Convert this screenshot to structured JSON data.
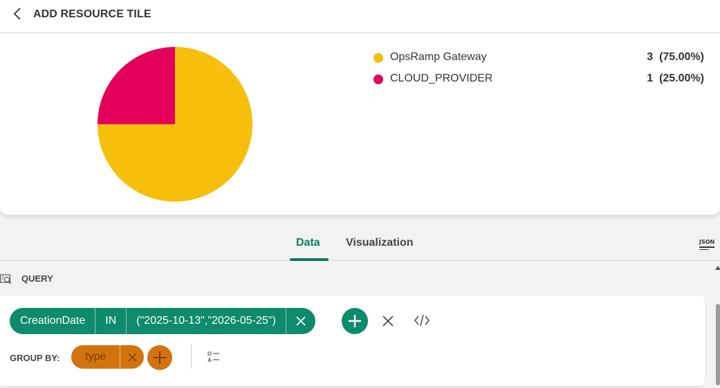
{
  "header": {
    "title": "ADD RESOURCE TILE",
    "back_icon": "chevron-left-icon"
  },
  "chart_data": {
    "type": "pie",
    "slices": [
      {
        "name": "OpsRamp Gateway",
        "value": 3,
        "percent": "75.00%",
        "color": "#f5bf0c",
        "display": "3  (75.00%)"
      },
      {
        "name": "CLOUD_PROVIDER",
        "value": 1,
        "percent": "25.00%",
        "color": "#e3005a",
        "display": "1  (25.00%)"
      }
    ],
    "legend_position": "right"
  },
  "tabs": [
    {
      "label": "Data",
      "active": true
    },
    {
      "label": "Visualization",
      "active": false
    }
  ],
  "json_icon_label": "JSON",
  "query": {
    "label": "QUERY",
    "filter": {
      "field": "CreationDate",
      "operator": "IN",
      "value": "(\"2025-10-13\",\"2026-05-25\")"
    },
    "group_by_label": "GROUP BY:",
    "group_by_value": "type"
  },
  "colors": {
    "accent": "#0e8a6c",
    "group": "#d2730e"
  }
}
